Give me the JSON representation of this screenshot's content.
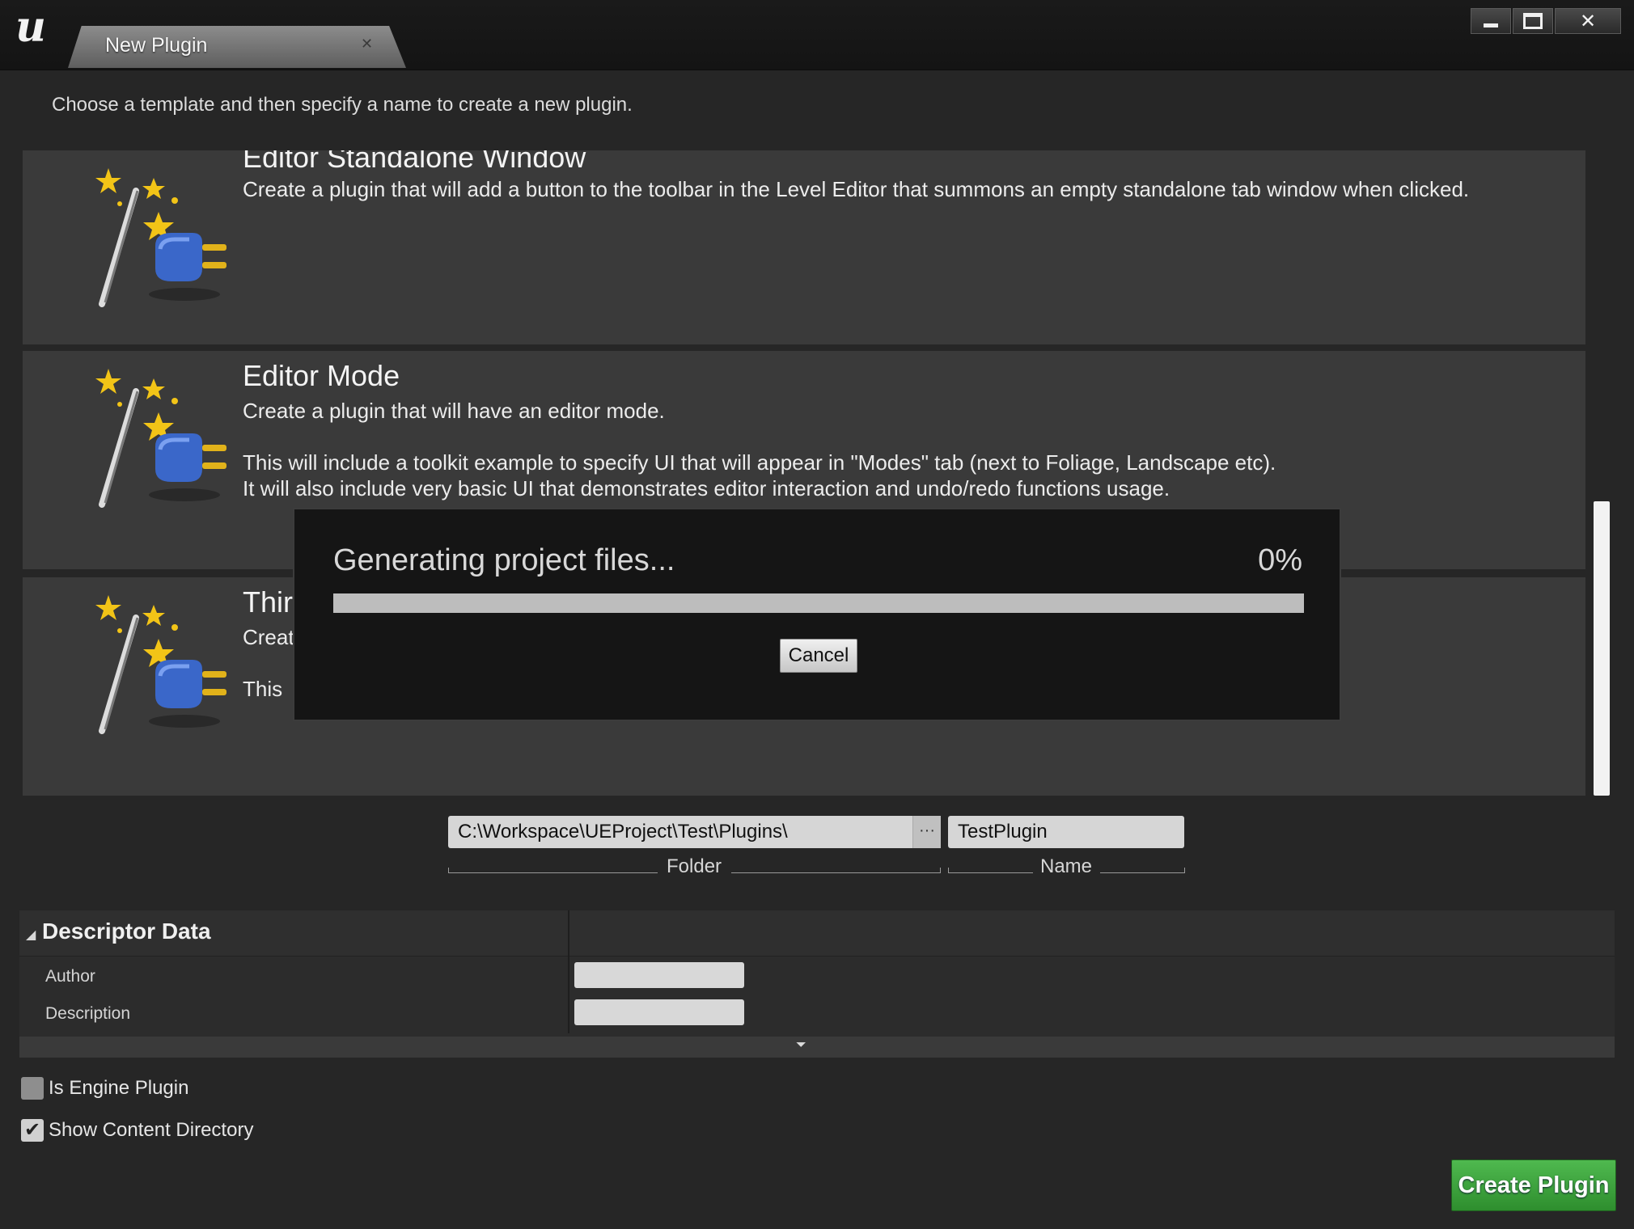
{
  "window": {
    "tab_title": "New Plugin",
    "tab_close_icon": "close-tab-icon",
    "controls": [
      "minimize-icon",
      "maximize-icon",
      "close-icon"
    ]
  },
  "intro": "Choose a template and then specify a name to create a new plugin.",
  "templates": [
    {
      "title": "Editor Standalone Window",
      "icon": "plugin-wand-icon",
      "lines": [
        "Create a plugin that will add a button to the toolbar in the Level Editor that summons an empty standalone tab window when clicked."
      ]
    },
    {
      "title": "Editor Mode",
      "icon": "plugin-wand-icon",
      "lines": [
        "Create a plugin that will have an editor mode.",
        "",
        "This will include a toolkit example to specify UI that will appear in \"Modes\" tab (next to Foliage, Landscape etc).",
        "It will also include very basic UI that demonstrates editor interaction and undo/redo functions usage."
      ]
    },
    {
      "title": "Thir",
      "icon": "plugin-wand-icon",
      "lines": [
        "Creat",
        "",
        "This"
      ]
    }
  ],
  "progress": {
    "title": "Generating project files...",
    "percent_label": "0%",
    "value": 0,
    "cancel_label": "Cancel"
  },
  "folder": {
    "value": "C:\\Workspace\\UEProject\\Test\\Plugins\\",
    "browse_label": "···",
    "caption": "Folder"
  },
  "name": {
    "value": "TestPlugin",
    "caption": "Name"
  },
  "descriptor": {
    "header": "Descriptor Data",
    "author_label": "Author",
    "author_value": "",
    "description_label": "Description",
    "description_value": ""
  },
  "options": {
    "engine_plugin_label": "Is Engine Plugin",
    "engine_plugin_checked": false,
    "content_dir_label": "Show Content Directory",
    "content_dir_checked": true
  },
  "create_label": "Create Plugin",
  "colors": {
    "create_button": "#3fa73f",
    "background": "#262626",
    "card": "#3a3a3a"
  }
}
